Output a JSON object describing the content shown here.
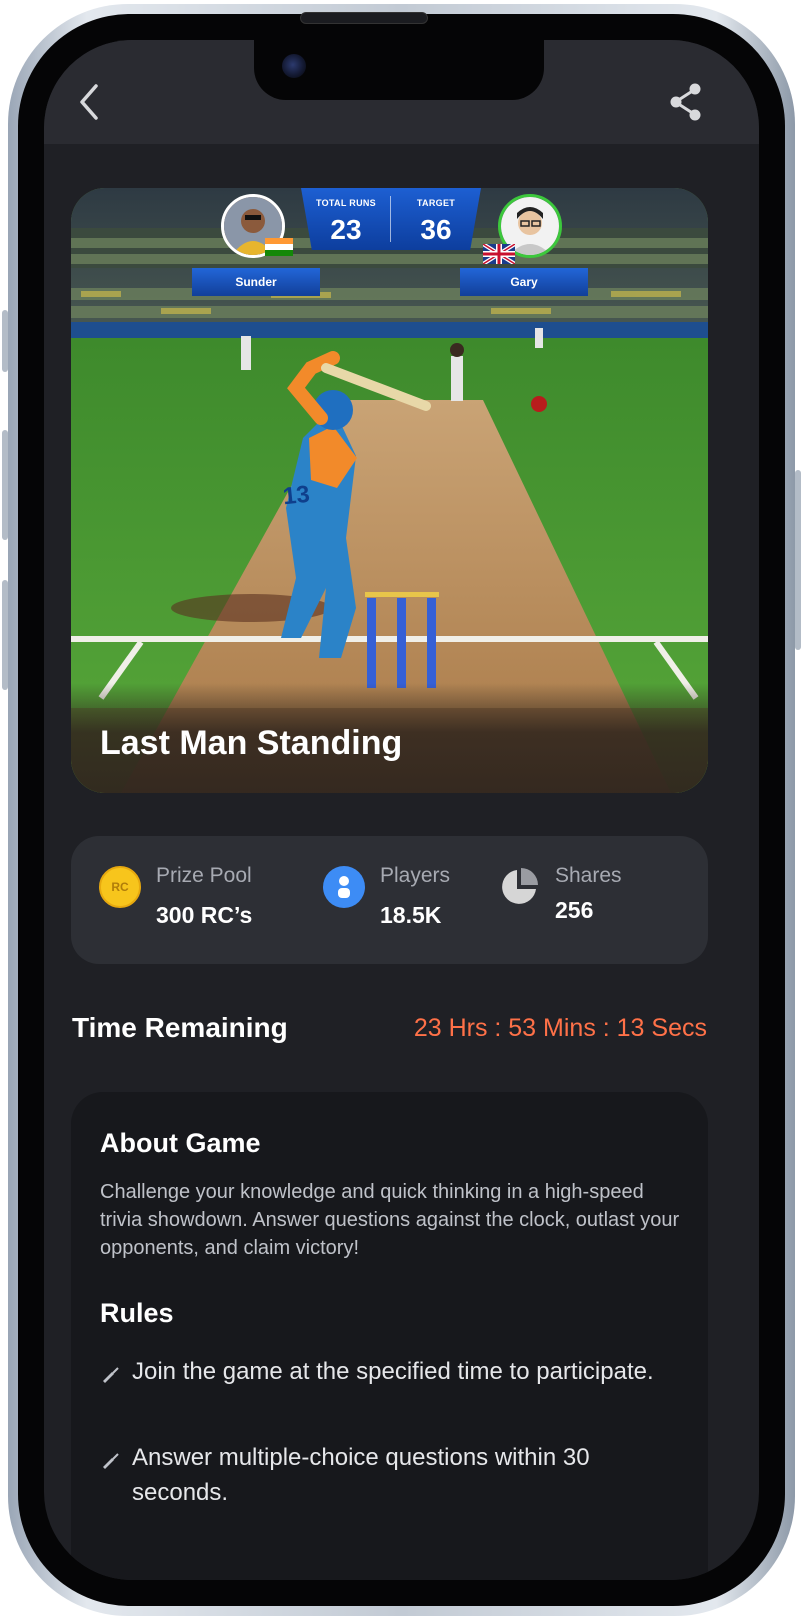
{
  "nav": {
    "back_icon": "chevron-left-icon",
    "share_icon": "share-icon"
  },
  "hero": {
    "title": "Last Man Standing",
    "scoreboard": {
      "total_runs_label": "TOTAL RUNS",
      "total_runs_value": "23",
      "target_label": "TARGET",
      "target_value": "36"
    },
    "player_left": {
      "name": "Sunder",
      "flag_icon": "india-flag-icon"
    },
    "player_right": {
      "name": "Gary",
      "flag_icon": "uk-flag-icon"
    },
    "shirt_number": "13"
  },
  "stats": [
    {
      "label": "Prize Pool",
      "value": "300 RC’s",
      "icon": "coin-icon",
      "icon_text": "RC",
      "color": "#f7c51c"
    },
    {
      "label": "Players",
      "value": "18.5K",
      "icon": "user-icon",
      "color": "#3d8cf5"
    },
    {
      "label": "Shares",
      "value": "256",
      "icon": "pie-chart-icon",
      "color": "#d6d6d6"
    }
  ],
  "time": {
    "label": "Time Remaining",
    "value": "23 Hrs : 53 Mins : 13 Secs",
    "color": "#ff7148"
  },
  "about": {
    "title": "About Game",
    "description": "Challenge your knowledge and quick thinking in a high-speed trivia showdown. Answer questions against the clock, outlast your opponents, and claim victory!",
    "rules_title": "Rules",
    "rules": [
      "Join the game at the specified time to participate.",
      "Answer multiple-choice questions within 30 seconds."
    ]
  }
}
